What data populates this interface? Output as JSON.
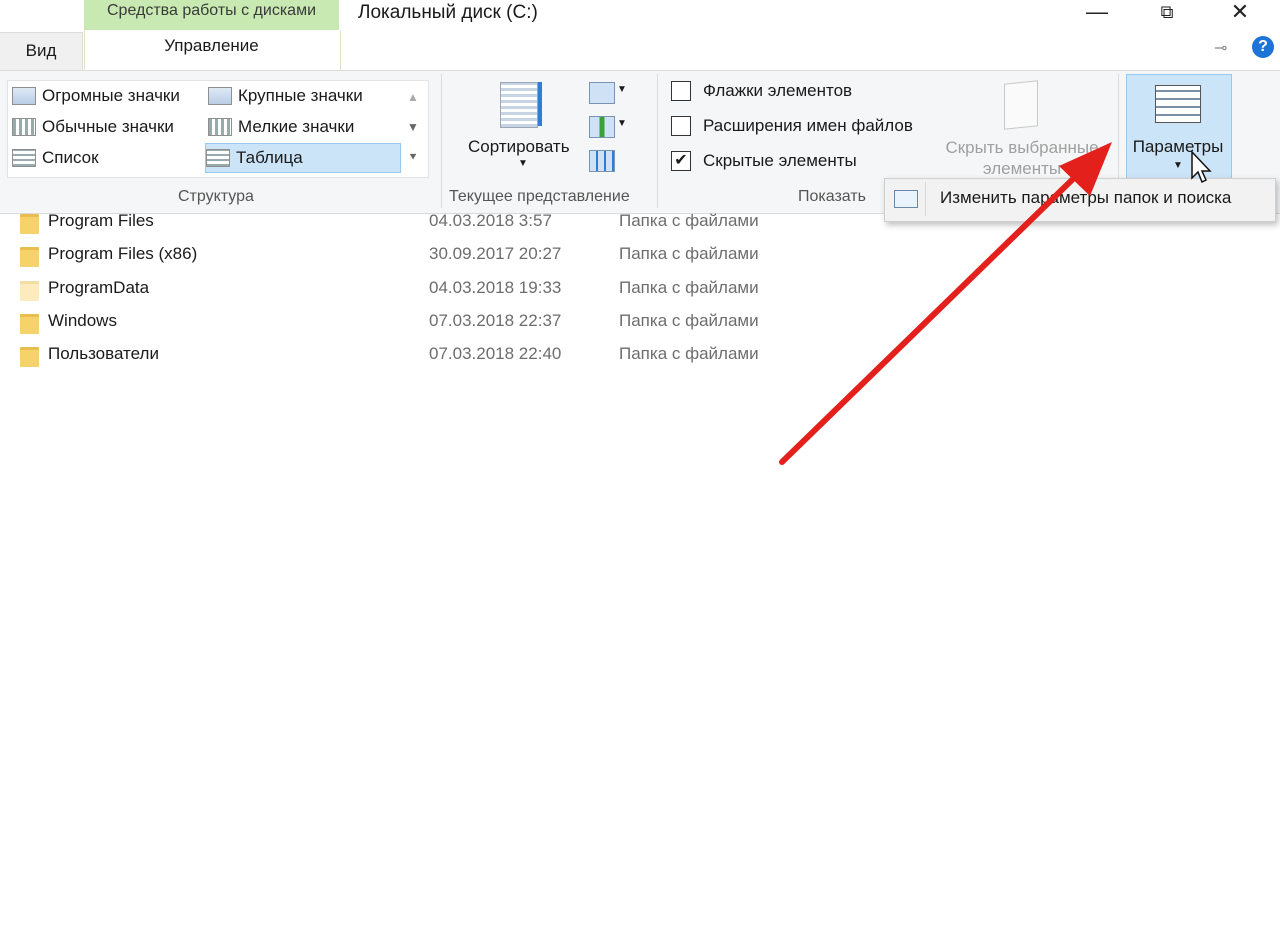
{
  "titlebar": {
    "context_tab": "Средства работы с дисками",
    "window_title": "Локальный диск (C:)",
    "minimize": "—",
    "restore": "⧉",
    "close": "✕"
  },
  "tabs": {
    "view": "Вид",
    "manage": "Управление"
  },
  "ribbon": {
    "layout": {
      "items": [
        "Огромные значки",
        "Крупные значки",
        "Обычные значки",
        "Мелкие значки",
        "Список",
        "Таблица"
      ],
      "selected": "Таблица",
      "group_label": "Структура"
    },
    "current_view": {
      "sort_label": "Сортировать",
      "group_label": "Текущее представление"
    },
    "show_hide": {
      "item_checkboxes": {
        "label": "Флажки элементов",
        "checked": false
      },
      "file_extensions": {
        "label": "Расширения имен файлов",
        "checked": false
      },
      "hidden_items": {
        "label": "Скрытые элементы",
        "checked": true
      },
      "hide_selected_line1": "Скрыть выбранные",
      "hide_selected_line2": "элементы",
      "group_label": "Показать"
    },
    "options": {
      "label": "Параметры"
    }
  },
  "dropdown": {
    "item": "Изменить параметры папок и поиска"
  },
  "files": [
    {
      "name": "Program Files",
      "date": "04.03.2018 3:57",
      "type": "Папка с файлами",
      "faded": false
    },
    {
      "name": "Program Files (x86)",
      "date": "30.09.2017 20:27",
      "type": "Папка с файлами",
      "faded": false
    },
    {
      "name": "ProgramData",
      "date": "04.03.2018 19:33",
      "type": "Папка с файлами",
      "faded": true
    },
    {
      "name": "Windows",
      "date": "07.03.2018 22:37",
      "type": "Папка с файлами",
      "faded": false
    },
    {
      "name": "Пользователи",
      "date": "07.03.2018 22:40",
      "type": "Папка с файлами",
      "faded": false
    }
  ],
  "colors": {
    "context_tab": "#c9e9b3",
    "selection": "#cce4f7",
    "accent_blue": "#1e73d6",
    "annotation_arrow": "#e3201b"
  }
}
